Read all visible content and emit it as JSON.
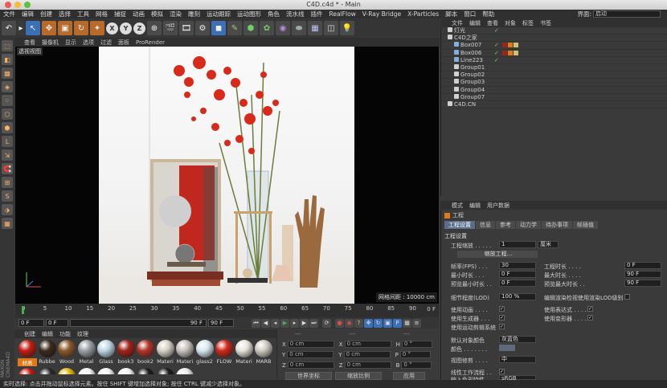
{
  "window": {
    "title": "C4D.c4d * - Main"
  },
  "menubar": {
    "items": [
      "文件",
      "编辑",
      "创建",
      "选择",
      "工具",
      "网格",
      "捕捉",
      "动画",
      "模拟",
      "渲染",
      "雕刻",
      "运动跟踪",
      "运动图形",
      "角色",
      "流水线",
      "插件",
      "RealFlow",
      "V-Ray Bridge",
      "X-Particles",
      "脚本",
      "窗口",
      "帮助"
    ],
    "layout_label": "界面:",
    "layout_value": "启动"
  },
  "viewport": {
    "menu": [
      "查看",
      "摄像机",
      "显示",
      "选项",
      "过滤",
      "面板",
      "ProRender"
    ],
    "label": "透视视图",
    "grid_spacing": "网格间距 : 10000 cm"
  },
  "timeline": {
    "ticks": [
      "0",
      "5",
      "10",
      "15",
      "20",
      "25",
      "30",
      "35",
      "40",
      "45",
      "50",
      "55",
      "60",
      "65",
      "70",
      "75",
      "80",
      "85",
      "90"
    ],
    "current_frame_label": "0 F"
  },
  "transport": {
    "start": "0 F",
    "current": "0 F",
    "end": "90 F",
    "end2": "90 F"
  },
  "materials": {
    "menu": [
      "创建",
      "编辑",
      "功能",
      "纹理"
    ],
    "items": [
      {
        "label": "材质",
        "color": "#c21d12",
        "selected": true
      },
      {
        "label": "Rubbe",
        "color": "#3b2a1e",
        "selected": false
      },
      {
        "label": "Wood",
        "color": "#8a5a2b",
        "selected": false
      },
      {
        "label": "Metal",
        "color": "#9aa0a6",
        "selected": false
      },
      {
        "label": "Glass",
        "color": "#bfd6e3",
        "selected": false
      },
      {
        "label": "book3",
        "color": "#a0231a",
        "selected": false
      },
      {
        "label": "book2",
        "color": "#b3362c",
        "selected": false
      },
      {
        "label": "Materi",
        "color": "#d6d0c6",
        "selected": false
      },
      {
        "label": "Materi",
        "color": "#c7c2ba",
        "selected": false
      },
      {
        "label": "glass2",
        "color": "#d8e8ef",
        "selected": false
      },
      {
        "label": "FLOW",
        "color": "#d0291a",
        "selected": false
      },
      {
        "label": "Materi",
        "color": "#e6e3dc",
        "selected": false
      },
      {
        "label": "MARB",
        "color": "#cfcac1",
        "selected": false
      }
    ],
    "row2_colors": [
      "#c21d12",
      "#2a2a2a",
      "#e0b60f",
      "#f2f2f2",
      "#f2f2f2",
      "#f2f2f2",
      "#1b1b1b",
      "#1b1b1b",
      "#e8e8e8"
    ]
  },
  "coords": {
    "header": [
      "---",
      "---",
      "---"
    ],
    "rows": [
      {
        "a": "X",
        "v1": "0 cm",
        "b": "X",
        "v2": "0 cm",
        "c": "H",
        "v3": "0 °"
      },
      {
        "a": "Y",
        "v1": "0 cm",
        "b": "Y",
        "v2": "0 cm",
        "c": "P",
        "v3": "0 °"
      },
      {
        "a": "Z",
        "v1": "0 cm",
        "b": "Z",
        "v2": "0 cm",
        "c": "B",
        "v3": "0 °"
      }
    ],
    "mode1": "世界坐标",
    "mode2": "缩放比例",
    "apply": "应用"
  },
  "objects": {
    "menu": [
      "文件",
      "编辑",
      "查看",
      "对象",
      "标签",
      "书签"
    ],
    "rows": [
      {
        "name": "灯光",
        "indent": 1,
        "color": "#d0d0d0",
        "check": "✓"
      },
      {
        "name": "C4D之家",
        "indent": 1,
        "color": "#d0d0d0",
        "check": ""
      },
      {
        "name": "Box007",
        "indent": 2,
        "color": "#7fb0e0",
        "check": "✓"
      },
      {
        "name": "Box006",
        "indent": 2,
        "color": "#7fb0e0",
        "check": "✓"
      },
      {
        "name": "Line223",
        "indent": 2,
        "color": "#7fb0e0",
        "check": "✓"
      },
      {
        "name": "Group01",
        "indent": 2,
        "color": "#d0d0d0",
        "check": ""
      },
      {
        "name": "Group02",
        "indent": 2,
        "color": "#d0d0d0",
        "check": ""
      },
      {
        "name": "Group03",
        "indent": 2,
        "color": "#d0d0d0",
        "check": ""
      },
      {
        "name": "Group04",
        "indent": 2,
        "color": "#d0d0d0",
        "check": ""
      },
      {
        "name": "Group07",
        "indent": 2,
        "color": "#d0d0d0",
        "check": ""
      },
      {
        "name": "C4D.CN",
        "indent": 1,
        "color": "#d0d0d0",
        "check": ""
      }
    ]
  },
  "attributes": {
    "menu": [
      "模式",
      "编辑",
      "用户数据"
    ],
    "title": "工程",
    "tabs": [
      "工程设置",
      "信息",
      "参考",
      "动力学",
      "待办事项",
      "帧插值"
    ],
    "section": "工程设置",
    "project_scale_label": "工程缩放 . . . . .",
    "project_scale_value": "1",
    "project_scale_unit": "厘米",
    "scale_project_button": "缩放工程...",
    "fps_label": "帧率(FPS) . . .",
    "fps_value": "30",
    "project_time_label": "工程时长 . . . .",
    "project_time_value": "0 F",
    "min_time_label": "最小时长 . . .",
    "min_time_value": "0 F",
    "max_time_label": "最大时长 . . . .",
    "max_time_value": "90 F",
    "preview_min_label": "预览最小时长 . .",
    "preview_min_value": "0 F",
    "preview_max_label": "预览最大时长 . .",
    "preview_max_value": "90 F",
    "lod_label": "细节程度(LOD)",
    "lod_value": "100 %",
    "lod_render_label": "编辑渲染检视使用渲染LOD级别",
    "use_animation": "使用动画 . . . .",
    "use_expressions": "使用表达式 . . . .",
    "use_generators": "使用生成器 . . .",
    "use_deformers": "使用变形器 . . . .",
    "use_motion_clip": "使用运动剪辑系统",
    "default_color_label": "默认对象颜色",
    "default_color_value": "灰蓝色",
    "color_label": "颜色 . . . . . . .",
    "view_clipping_label": "视图修剪 . . . .",
    "view_clipping_value": "中",
    "linear_workflow_label": "线性工作流程 . .",
    "input_color_label": "输入色彩特性 . .",
    "input_color_value": "sRGB"
  },
  "status": {
    "text": "实时选择: 点击并拖动鼠标选择元素。按住 SHIFT 键增加选择对象; 按住 CTRL 键减少选择对象。"
  }
}
